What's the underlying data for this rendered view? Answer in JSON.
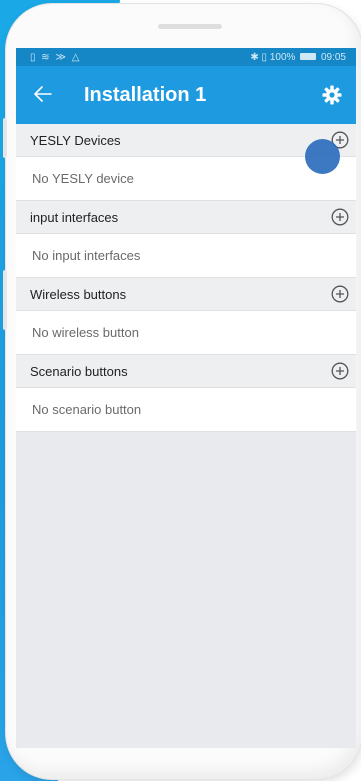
{
  "statusbar": {
    "left_icons": [
      "sim-icon",
      "wifi-icon",
      "cast-icon",
      "warning-icon"
    ],
    "bluetooth": "✱",
    "vibrate": "▯",
    "battery_pct": "100%",
    "time": "09:05"
  },
  "appbar": {
    "back_icon": "arrow-left-icon",
    "title": "Installation 1",
    "settings_icon": "gear-icon"
  },
  "sections": [
    {
      "header": "YESLY Devices",
      "empty": "No YESLY device"
    },
    {
      "header": "input interfaces",
      "empty": "No input interfaces"
    },
    {
      "header": "Wireless buttons",
      "empty": "No wireless button"
    },
    {
      "header": "Scenario buttons",
      "empty": "No scenario button"
    }
  ],
  "colors": {
    "appbar": "#1e9be0",
    "statusbar": "#1587c6",
    "touch_indicator": "#2d6ebd"
  }
}
